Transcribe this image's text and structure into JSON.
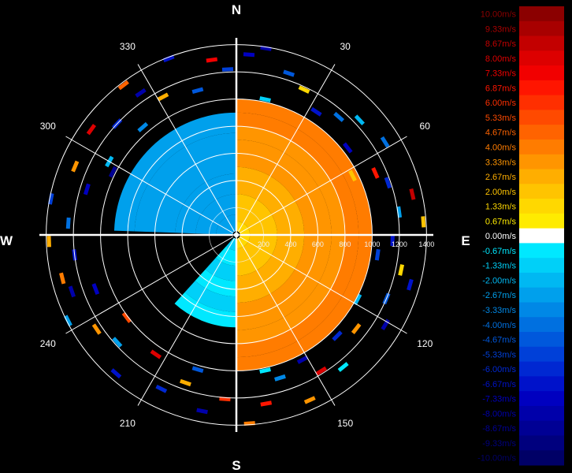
{
  "chart_data": {
    "type": "polar-radial-velocity",
    "cardinal_labels": [
      "N",
      "E",
      "S",
      "W"
    ],
    "bearing_labels": [
      "30",
      "60",
      "120",
      "150",
      "210",
      "240",
      "300",
      "330"
    ],
    "bearing_angles_deg": [
      30,
      60,
      120,
      150,
      210,
      240,
      300,
      330
    ],
    "range_ticks": [
      "200",
      "400",
      "600",
      "800",
      "1000",
      "1200",
      "1400"
    ],
    "range_tick_values": [
      200,
      400,
      600,
      800,
      1000,
      1200,
      1400
    ],
    "range_rings": [
      400,
      600,
      800,
      1000,
      1200,
      1400
    ],
    "range_max": 1450,
    "colorbar": {
      "unit": "m/s",
      "levels": [
        {
          "label": "10.00m/s",
          "value": 10.0,
          "color": "#8b0000"
        },
        {
          "label": "9.33m/s",
          "value": 9.33,
          "color": "#a80000"
        },
        {
          "label": "8.67m/s",
          "value": 8.67,
          "color": "#c30000"
        },
        {
          "label": "8.00m/s",
          "value": 8.0,
          "color": "#dd0000"
        },
        {
          "label": "7.33m/s",
          "value": 7.33,
          "color": "#f20000"
        },
        {
          "label": "6.87m/s",
          "value": 6.87,
          "color": "#ff1500"
        },
        {
          "label": "6.00m/s",
          "value": 6.0,
          "color": "#ff2f00"
        },
        {
          "label": "5.33m/s",
          "value": 5.33,
          "color": "#ff4a00"
        },
        {
          "label": "4.67m/s",
          "value": 4.67,
          "color": "#ff6300"
        },
        {
          "label": "4.00m/s",
          "value": 4.0,
          "color": "#ff7c00"
        },
        {
          "label": "3.33m/s",
          "value": 3.33,
          "color": "#ff9500"
        },
        {
          "label": "2.67m/s",
          "value": 2.67,
          "color": "#ffae00"
        },
        {
          "label": "2.00m/s",
          "value": 2.0,
          "color": "#ffc400"
        },
        {
          "label": "1.33m/s",
          "value": 1.33,
          "color": "#ffd800"
        },
        {
          "label": "0.67m/s",
          "value": 0.67,
          "color": "#ffeb00"
        },
        {
          "label": "0.00m/s",
          "value": 0.0,
          "color": "#ffffff"
        },
        {
          "label": "-0.67m/s",
          "value": -0.67,
          "color": "#00e8ff"
        },
        {
          "label": "-1.33m/s",
          "value": -1.33,
          "color": "#00d0f8"
        },
        {
          "label": "-2.00m/s",
          "value": -2.0,
          "color": "#00b8f2"
        },
        {
          "label": "-2.67m/s",
          "value": -2.67,
          "color": "#00a0ec"
        },
        {
          "label": "-3.33m/s",
          "value": -3.33,
          "color": "#0088e6"
        },
        {
          "label": "-4.00m/s",
          "value": -4.0,
          "color": "#0070e0"
        },
        {
          "label": "-4.67m/s",
          "value": -4.67,
          "color": "#0058dc"
        },
        {
          "label": "-5.33m/s",
          "value": -5.33,
          "color": "#0040d8"
        },
        {
          "label": "-6.00m/s",
          "value": -6.0,
          "color": "#0028d2"
        },
        {
          "label": "-6.67m/s",
          "value": -6.67,
          "color": "#0012ca"
        },
        {
          "label": "-7.33m/s",
          "value": -7.33,
          "color": "#0000c0"
        },
        {
          "label": "-8.00m/s",
          "value": -8.0,
          "color": "#0000aa"
        },
        {
          "label": "-8.67m/s",
          "value": -8.67,
          "color": "#000094"
        },
        {
          "label": "-9.33m/s",
          "value": -9.33,
          "color": "#00007e"
        },
        {
          "label": "-10.00m/s",
          "value": -10.0,
          "color": "#000066"
        }
      ]
    },
    "core_velocity_field": {
      "east_half": {
        "from_deg": 0,
        "to_deg": 180,
        "inner_value": 1.6,
        "outer_value": 4.2,
        "max_range": 1000
      },
      "west_half": [
        {
          "from_deg": 180,
          "to_deg": 222,
          "value": -1.3,
          "max_range": 680
        },
        {
          "from_deg": 272,
          "to_deg": 360,
          "value": -3.0,
          "max_range": 900
        }
      ]
    },
    "scattered_gates": [
      {
        "az": 4,
        "r": 1330,
        "v": -7.2
      },
      {
        "az": 9,
        "r": 1390,
        "v": -8.0
      },
      {
        "az": 18,
        "r": 1250,
        "v": -5.0
      },
      {
        "az": 25,
        "r": 1180,
        "v": 1.5
      },
      {
        "az": 33,
        "r": 1080,
        "v": -6.8
      },
      {
        "az": 41,
        "r": 1150,
        "v": -3.8
      },
      {
        "az": 47,
        "r": 1240,
        "v": -1.8
      },
      {
        "az": 52,
        "r": 1040,
        "v": -7.5
      },
      {
        "az": 58,
        "r": 1290,
        "v": -4.0
      },
      {
        "az": 63,
        "r": 960,
        "v": 2.2
      },
      {
        "az": 71,
        "r": 1180,
        "v": -6.0
      },
      {
        "az": 77,
        "r": 1330,
        "v": 8.5
      },
      {
        "az": 82,
        "r": 1210,
        "v": -2.8
      },
      {
        "az": 86,
        "r": 1380,
        "v": 1.8
      },
      {
        "az": 92,
        "r": 1150,
        "v": -7.0
      },
      {
        "az": 98,
        "r": 1050,
        "v": -5.5
      },
      {
        "az": 106,
        "r": 1330,
        "v": -6.5
      },
      {
        "az": 113,
        "r": 1200,
        "v": -4.5
      },
      {
        "az": 121,
        "r": 1280,
        "v": -8.0
      },
      {
        "az": 128,
        "r": 1120,
        "v": 3.0
      },
      {
        "az": 135,
        "r": 1050,
        "v": -6.2
      },
      {
        "az": 141,
        "r": 1250,
        "v": -0.4
      },
      {
        "az": 148,
        "r": 1180,
        "v": 7.8
      },
      {
        "az": 156,
        "r": 1330,
        "v": 3.5
      },
      {
        "az": 163,
        "r": 1100,
        "v": -3.2
      },
      {
        "az": 170,
        "r": 1260,
        "v": 6.6
      },
      {
        "az": 176,
        "r": 1390,
        "v": 3.8
      },
      {
        "az": 184,
        "r": 1210,
        "v": 6.0
      },
      {
        "az": 191,
        "r": 1320,
        "v": -7.8
      },
      {
        "az": 199,
        "r": 1150,
        "v": 2.4
      },
      {
        "az": 206,
        "r": 1260,
        "v": -5.8
      },
      {
        "az": 214,
        "r": 1060,
        "v": 8.0
      },
      {
        "az": 221,
        "r": 1350,
        "v": -7.0
      },
      {
        "az": 228,
        "r": 1180,
        "v": -3.0
      },
      {
        "az": 236,
        "r": 1240,
        "v": 3.2
      },
      {
        "az": 243,
        "r": 1390,
        "v": -2.5
      },
      {
        "az": 249,
        "r": 1110,
        "v": -7.5
      },
      {
        "az": 256,
        "r": 1320,
        "v": 4.2
      },
      {
        "az": 263,
        "r": 1200,
        "v": -6.5
      },
      {
        "az": 268,
        "r": 1380,
        "v": 2.5
      },
      {
        "az": 274,
        "r": 1240,
        "v": -4.2
      },
      {
        "az": 281,
        "r": 1390,
        "v": -5.5
      },
      {
        "az": 287,
        "r": 1150,
        "v": -7.2
      },
      {
        "az": 293,
        "r": 1290,
        "v": 3.5
      },
      {
        "az": 300,
        "r": 1080,
        "v": -2.2
      },
      {
        "az": 306,
        "r": 1320,
        "v": 8.2
      },
      {
        "az": 313,
        "r": 1200,
        "v": -6.0
      },
      {
        "az": 319,
        "r": 1050,
        "v": -3.5
      },
      {
        "az": 326,
        "r": 1260,
        "v": -8.0
      },
      {
        "az": 332,
        "r": 1150,
        "v": 2.8
      },
      {
        "az": 339,
        "r": 1390,
        "v": -6.8
      },
      {
        "az": 345,
        "r": 1100,
        "v": -4.8
      },
      {
        "az": 352,
        "r": 1300,
        "v": 7.4
      },
      {
        "az": 357,
        "r": 1220,
        "v": -5.2
      },
      {
        "az": 12,
        "r": 1020,
        "v": -1.5
      },
      {
        "az": 66,
        "r": 1120,
        "v": 6.5
      },
      {
        "az": 102,
        "r": 1240,
        "v": 1.2
      },
      {
        "az": 118,
        "r": 1010,
        "v": -2.0
      },
      {
        "az": 152,
        "r": 1040,
        "v": -7.7
      },
      {
        "az": 168,
        "r": 1020,
        "v": -0.6
      },
      {
        "az": 196,
        "r": 1030,
        "v": -4.4
      },
      {
        "az": 233,
        "r": 1010,
        "v": 5.2
      },
      {
        "az": 251,
        "r": 1280,
        "v": -7.9
      },
      {
        "az": 297,
        "r": 1020,
        "v": -8.5
      },
      {
        "az": 323,
        "r": 1380,
        "v": 4.8
      }
    ]
  }
}
